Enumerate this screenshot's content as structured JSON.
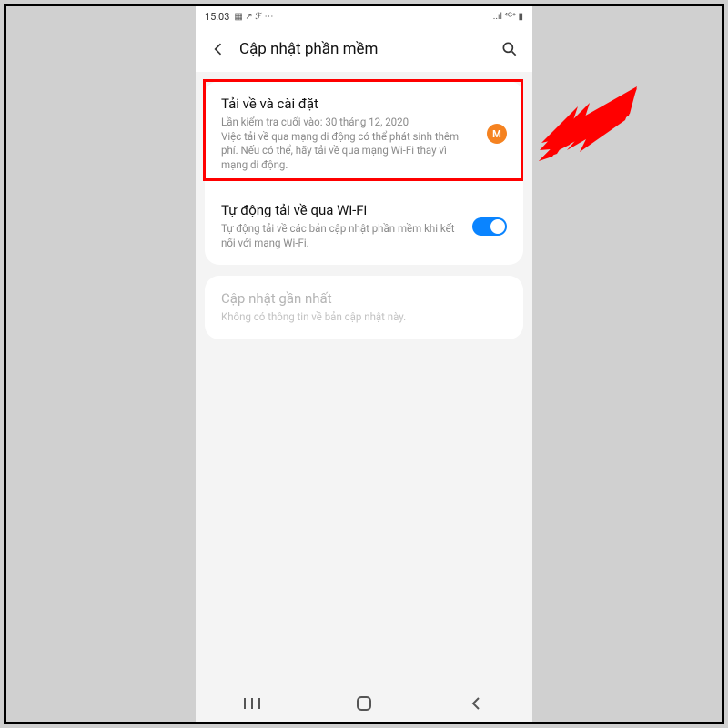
{
  "statusbar": {
    "time": "15:03",
    "icons_left": "▦ ↗ ℱ ⋯",
    "icons_right": "..ıl ⁴ᴳ⁺ ▮"
  },
  "appbar": {
    "title": "Cập nhật phần mềm"
  },
  "cards": {
    "download": {
      "title": "Tải về và cài đặt",
      "sub": "Lần kiểm tra cuối vào: 30 tháng 12, 2020\nViệc tải về qua mạng di động có thể phát sinh thêm phí. Nếu có thể, hãy tải về qua mạng Wi-Fi thay vì mạng di động.",
      "badge": "M"
    },
    "autowifi": {
      "title": "Tự động tải về qua Wi-Fi",
      "sub": "Tự động tải về các bản cập nhật phần mềm khi kết nối với mạng Wi-Fi."
    },
    "last": {
      "title": "Cập nhật gần nhất",
      "sub": "Không có thông tin về bản cập nhật này."
    }
  }
}
